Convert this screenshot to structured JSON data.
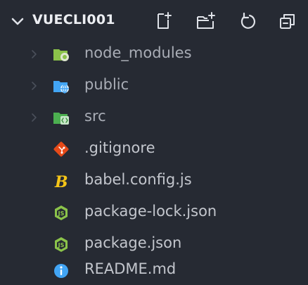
{
  "explorer": {
    "title": "VUECLI001",
    "header_icons": [
      "chevron-down-icon",
      "new-file-icon",
      "new-folder-icon",
      "refresh-icon",
      "collapse-all-icon"
    ],
    "items": [
      {
        "label": "node_modules",
        "kind": "folder",
        "icon": "node-folder-icon",
        "color": "#8bc34a"
      },
      {
        "label": "public",
        "kind": "folder",
        "icon": "public-folder-icon",
        "color": "#42a5f5"
      },
      {
        "label": "src",
        "kind": "folder",
        "icon": "src-folder-icon",
        "color": "#4caf50"
      },
      {
        "label": ".gitignore",
        "kind": "file",
        "icon": "git-icon",
        "color": "#e64a19"
      },
      {
        "label": "babel.config.js",
        "kind": "file",
        "icon": "babel-icon",
        "color": "#f5c518"
      },
      {
        "label": "package-lock.json",
        "kind": "file",
        "icon": "nodejs-icon",
        "color": "#8bc34a"
      },
      {
        "label": "package.json",
        "kind": "file",
        "icon": "nodejs-icon",
        "color": "#8bc34a"
      },
      {
        "label": "README.md",
        "kind": "file",
        "icon": "info-icon",
        "color": "#42a5f5"
      }
    ]
  }
}
